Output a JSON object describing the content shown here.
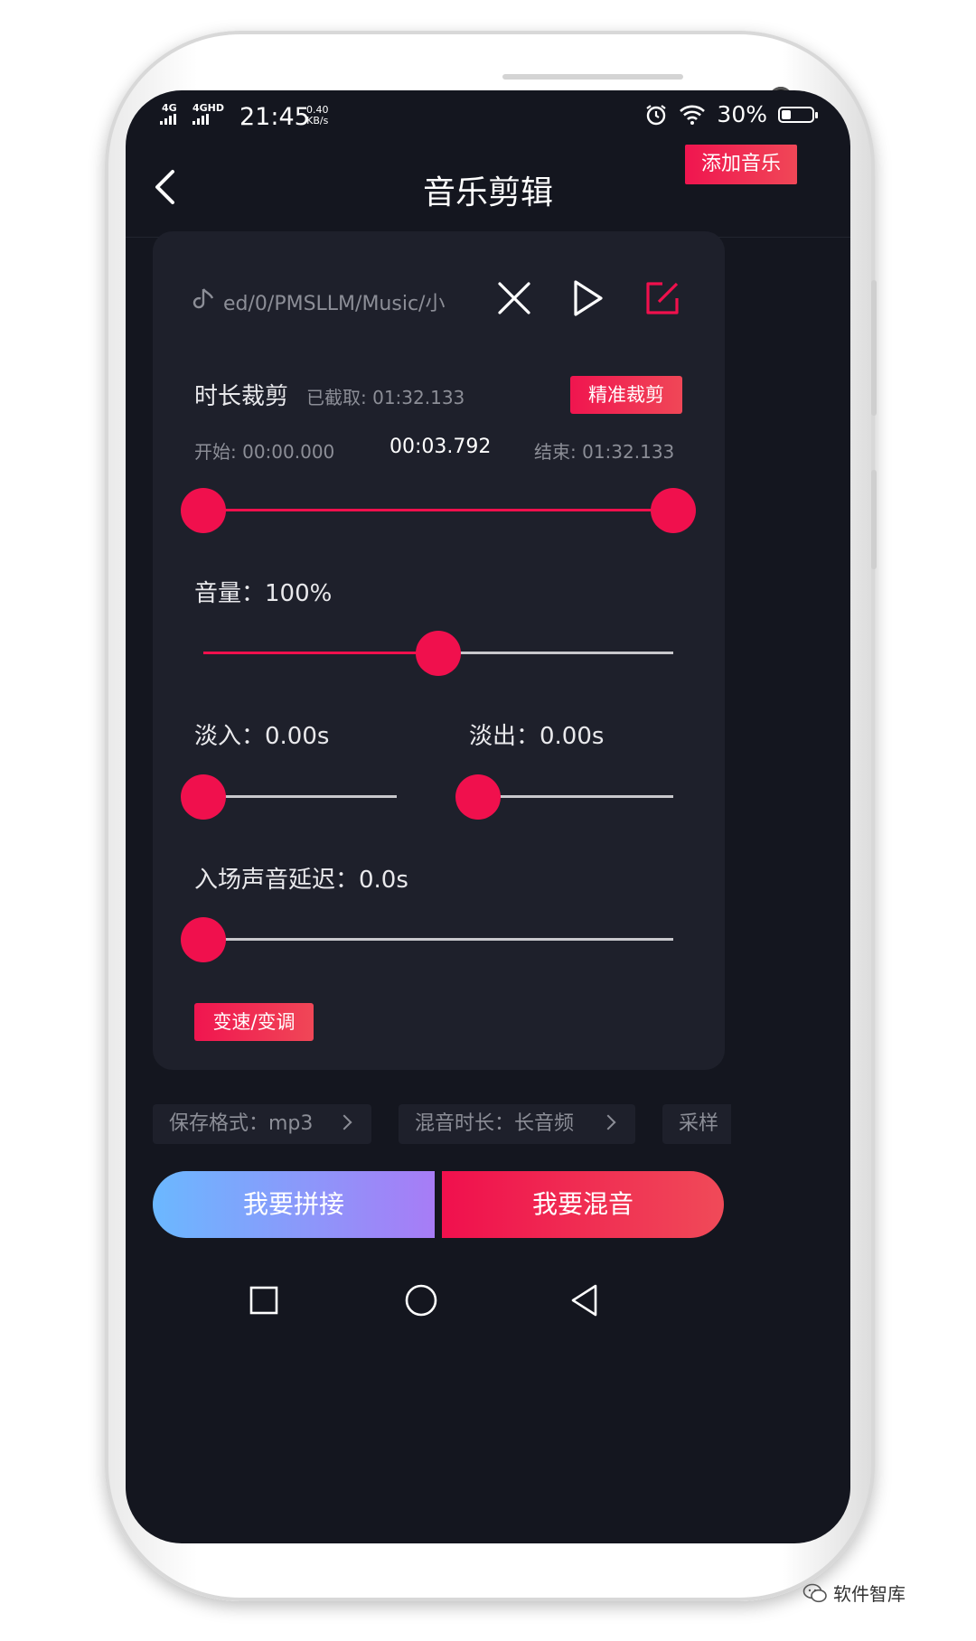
{
  "status_bar": {
    "network1": "4G",
    "network2": "4GHD",
    "time": "21:45",
    "speed_value": "0.40",
    "speed_unit": "KB/s",
    "battery": "30%",
    "battery_level": 0.3
  },
  "header": {
    "title": "音乐剪辑",
    "add_music_label": "添加音乐"
  },
  "track": {
    "path": "ed/0/PMSLLM/Music/小"
  },
  "trim": {
    "title": "时长裁剪",
    "clipped_text": "已截取: 01:32.133",
    "precise_label": "精准裁剪",
    "start_text": "开始: 00:00.000",
    "current_time": "00:03.792",
    "end_text": "结束: 01:32.133",
    "start_fraction": 0.0,
    "end_fraction": 1.0
  },
  "volume": {
    "label": "音量：100%",
    "level_fraction": 0.5
  },
  "fade_in": {
    "label": "淡入：0.00s",
    "level_fraction": 0.0
  },
  "fade_out": {
    "label": "淡出：0.00s",
    "level_fraction": 0.0
  },
  "delay": {
    "label": "入场声音延迟：0.0s",
    "level_fraction": 0.0
  },
  "speed_pitch_label": "变速/变调",
  "options": {
    "format": "保存格式：mp3",
    "mix_length": "混音时长：长音频",
    "sample": "采样"
  },
  "actions": {
    "join_label": "我要拼接",
    "mix_label": "我要混音"
  },
  "watermark": "软件智库",
  "colors": {
    "accent": "#f0104d",
    "background": "#14161f",
    "card": "#1e202b"
  }
}
